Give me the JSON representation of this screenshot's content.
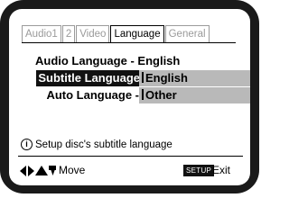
{
  "tabs": {
    "audio1": "Audio1",
    "audio2": "2",
    "video": "Video",
    "language": "Language",
    "general": "General"
  },
  "settings": [
    {
      "label": "Audio Language",
      "separator": " - ",
      "value": "English"
    },
    {
      "label": "Subtitle Language",
      "value": "English"
    },
    {
      "label": "Auto Language -",
      "value": "Other"
    }
  ],
  "help_text": "Setup disc's subtitle language",
  "footer": {
    "move_label": "Move",
    "setup_label": "SETUP",
    "exit_label": "Exit"
  },
  "icons": {
    "info": "info-icon",
    "arrows": [
      "arrow-left-icon",
      "arrow-right-icon",
      "arrow-up-icon",
      "arrow-down-icon"
    ]
  },
  "colors": {
    "selected_bg": "#111111",
    "value_box": "#b9b9b9",
    "inactive_tab": "#9a9a9a"
  }
}
